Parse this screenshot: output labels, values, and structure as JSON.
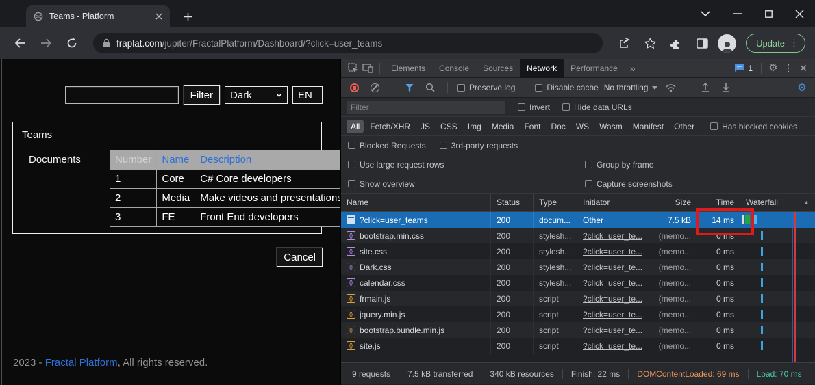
{
  "browser": {
    "tab_title": "Teams - Platform",
    "url": {
      "domain": "fraplat.com",
      "path": "/jupiter/FractalPlatform/Dashboard/?click=user_teams"
    },
    "update_label": "Update"
  },
  "page": {
    "filter_button": "Filter",
    "theme_select_value": "Dark",
    "lang_select_value": "EN",
    "teams_label": "Teams",
    "documents_label": "Documents",
    "teams_table": {
      "headers": [
        "Number",
        "Name",
        "Description"
      ],
      "rows": [
        [
          "1",
          "Core",
          "C# Core developers"
        ],
        [
          "2",
          "Media",
          "Make videos and presentations"
        ],
        [
          "3",
          "FE",
          "Front End developers"
        ]
      ]
    },
    "cancel_button": "Cancel",
    "footer": {
      "prefix": "2023 - ",
      "link": "Fractal Platform",
      "suffix": ", All rights reserved."
    }
  },
  "devtools": {
    "tabs": [
      "Elements",
      "Console",
      "Sources",
      "Network",
      "Performance"
    ],
    "active_tab": "Network",
    "issues_count": "1",
    "toolbar": {
      "preserve_log": "Preserve log",
      "disable_cache": "Disable cache",
      "throttling_value": "No throttling"
    },
    "filter_placeholder": "Filter",
    "invert_label": "Invert",
    "hide_data_urls_label": "Hide data URLs",
    "type_filters": [
      "All",
      "Fetch/XHR",
      "JS",
      "CSS",
      "Img",
      "Media",
      "Font",
      "Doc",
      "WS",
      "Wasm",
      "Manifest",
      "Other"
    ],
    "active_type_filter": "All",
    "has_blocked_cookies_label": "Has blocked cookies",
    "blocked_requests_label": "Blocked Requests",
    "third_party_label": "3rd-party requests",
    "use_large_rows_label": "Use large request rows",
    "group_by_frame_label": "Group by frame",
    "show_overview_label": "Show overview",
    "capture_screenshots_label": "Capture screenshots",
    "grid": {
      "columns": [
        "Name",
        "Status",
        "Type",
        "Initiator",
        "Size",
        "Time",
        "Waterfall"
      ],
      "requests": [
        {
          "icon": "doc",
          "name": "?click=user_teams",
          "status": "200",
          "type": "docum...",
          "initiator": "Other",
          "initiator_link": false,
          "size": "7.5 kB",
          "time": "14 ms",
          "selected": true
        },
        {
          "icon": "css",
          "name": "bootstrap.min.css",
          "status": "200",
          "type": "stylesh...",
          "initiator": "?click=user_te...",
          "initiator_link": true,
          "size": "(memo...",
          "time": "0 ms"
        },
        {
          "icon": "css",
          "name": "site.css",
          "status": "200",
          "type": "stylesh...",
          "initiator": "?click=user_te...",
          "initiator_link": true,
          "size": "(memo...",
          "time": "0 ms"
        },
        {
          "icon": "css",
          "name": "Dark.css",
          "status": "200",
          "type": "stylesh...",
          "initiator": "?click=user_te...",
          "initiator_link": true,
          "size": "(memo...",
          "time": "0 ms"
        },
        {
          "icon": "css",
          "name": "calendar.css",
          "status": "200",
          "type": "stylesh...",
          "initiator": "?click=user_te...",
          "initiator_link": true,
          "size": "(memo...",
          "time": "0 ms"
        },
        {
          "icon": "js",
          "name": "frmain.js",
          "status": "200",
          "type": "script",
          "initiator": "?click=user_te...",
          "initiator_link": true,
          "size": "(memo...",
          "time": "0 ms"
        },
        {
          "icon": "js",
          "name": "jquery.min.js",
          "status": "200",
          "type": "script",
          "initiator": "?click=user_te...",
          "initiator_link": true,
          "size": "(memo...",
          "time": "0 ms"
        },
        {
          "icon": "js",
          "name": "bootstrap.bundle.min.js",
          "status": "200",
          "type": "script",
          "initiator": "?click=user_te...",
          "initiator_link": true,
          "size": "(memo...",
          "time": "0 ms"
        },
        {
          "icon": "js",
          "name": "site.js",
          "status": "200",
          "type": "script",
          "initiator": "?click=user_te...",
          "initiator_link": true,
          "size": "(memo...",
          "time": "0 ms"
        }
      ]
    },
    "status_bar": [
      {
        "text": "9 requests"
      },
      {
        "text": "7.5 kB transferred"
      },
      {
        "text": "340 kB resources"
      },
      {
        "text": "Finish: 22 ms"
      },
      {
        "text": "DOMContentLoaded: 69 ms",
        "tone": "dcl"
      },
      {
        "text": "Load: 70 ms",
        "tone": "load"
      }
    ]
  },
  "colors": {
    "selected_row": "#1a6cb5",
    "annotation_red": "#e01a1a",
    "waterfall_tick": "#3ba3e0",
    "waterfall_bar_white": "#d9dde2",
    "waterfall_bar_green": "#27a53d",
    "waterfall_bar_blue": "#4db5f0",
    "load_line_red": "#d43a3a",
    "dcl_line_blue": "#3b62c9",
    "dcl_text": "#e8945a",
    "load_text": "#48c7ab",
    "link_blue": "#2e6fd8",
    "update_green": "#8fd49a"
  }
}
